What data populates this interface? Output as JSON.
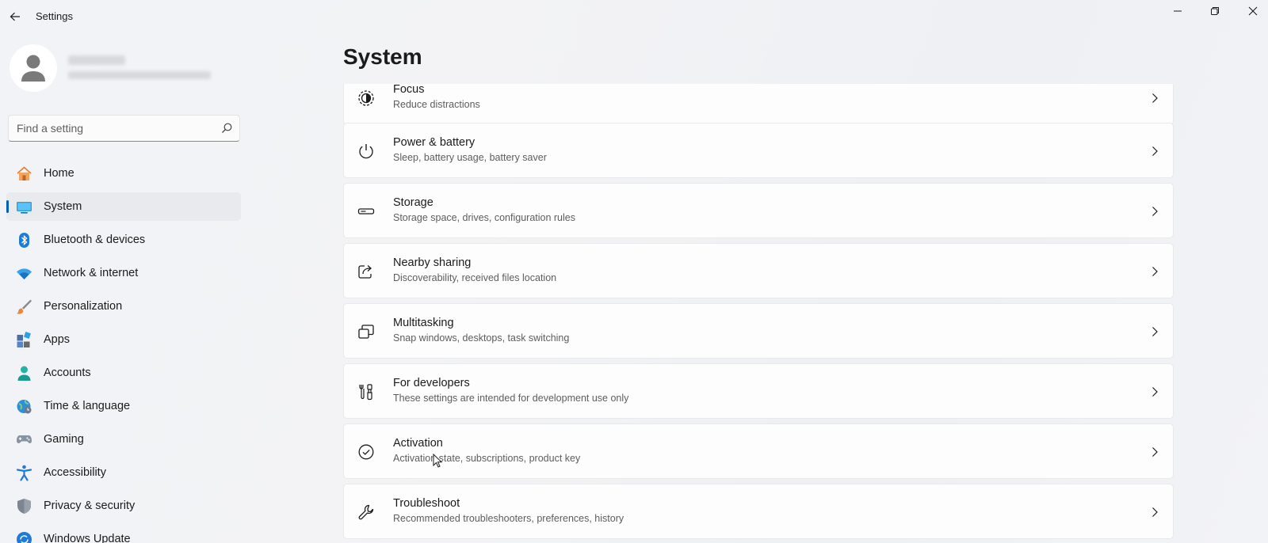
{
  "app": {
    "title": "Settings"
  },
  "window": {
    "minimize": "minimize",
    "maximize": "restore",
    "close": "close"
  },
  "search": {
    "placeholder": "Find a setting"
  },
  "nav": {
    "items": [
      {
        "label": "Home",
        "icon": "home-icon"
      },
      {
        "label": "System",
        "icon": "system-icon",
        "active": true
      },
      {
        "label": "Bluetooth & devices",
        "icon": "bluetooth-icon"
      },
      {
        "label": "Network & internet",
        "icon": "wifi-icon"
      },
      {
        "label": "Personalization",
        "icon": "brush-icon"
      },
      {
        "label": "Apps",
        "icon": "apps-icon"
      },
      {
        "label": "Accounts",
        "icon": "account-icon"
      },
      {
        "label": "Time & language",
        "icon": "globe-clock-icon"
      },
      {
        "label": "Gaming",
        "icon": "gamepad-icon"
      },
      {
        "label": "Accessibility",
        "icon": "accessibility-icon"
      },
      {
        "label": "Privacy & security",
        "icon": "shield-icon"
      },
      {
        "label": "Windows Update",
        "icon": "update-icon"
      }
    ]
  },
  "main": {
    "title": "System",
    "cards": [
      {
        "title": "Focus",
        "desc": "Reduce distractions",
        "icon": "focus-icon"
      },
      {
        "title": "Power & battery",
        "desc": "Sleep, battery usage, battery saver",
        "icon": "power-icon"
      },
      {
        "title": "Storage",
        "desc": "Storage space, drives, configuration rules",
        "icon": "storage-icon"
      },
      {
        "title": "Nearby sharing",
        "desc": "Discoverability, received files location",
        "icon": "share-icon"
      },
      {
        "title": "Multitasking",
        "desc": "Snap windows, desktops, task switching",
        "icon": "multitasking-icon"
      },
      {
        "title": "For developers",
        "desc": "These settings are intended for development use only",
        "icon": "developer-tools-icon"
      },
      {
        "title": "Activation",
        "desc": "Activation state, subscriptions, product key",
        "icon": "activation-check-icon"
      },
      {
        "title": "Troubleshoot",
        "desc": "Recommended troubleshooters, preferences, history",
        "icon": "wrench-icon"
      }
    ]
  },
  "colors": {
    "accent": "#005fb8",
    "background": "#f3f3f5",
    "card": "#fdfdfd"
  }
}
